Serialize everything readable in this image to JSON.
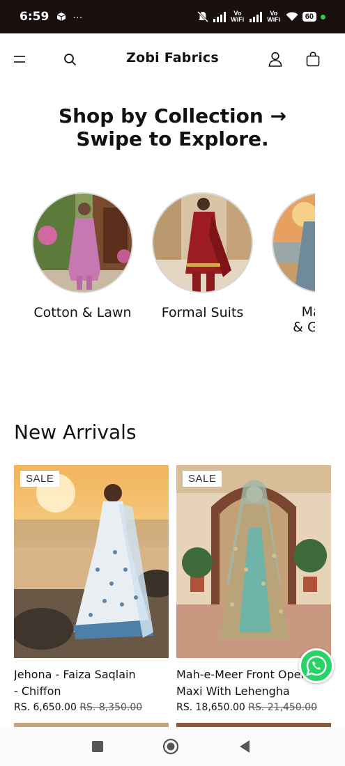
{
  "status_bar": {
    "time": "6:59",
    "notif_more": "···",
    "network_1": "Vo WiFi",
    "network_2": "Vo WiFi",
    "battery": "60"
  },
  "header": {
    "brand": "Zobi Fabrics"
  },
  "collections": {
    "heading_line1": "Shop by Collection →",
    "heading_line2": "Swipe to Explore.",
    "items": [
      {
        "label": "Cotton & Lawn"
      },
      {
        "label": "Formal Suits"
      },
      {
        "label": "Maxi's",
        "label_line2": "& Gowns"
      }
    ]
  },
  "new_arrivals": {
    "title": "New Arrivals",
    "products": [
      {
        "badge": "SALE",
        "name_line1": "Jehona - Faiza Saqlain",
        "name_line2": "- Chiffon",
        "price": "RS. 6,650.00",
        "compare_price": "RS. 8,350.00"
      },
      {
        "badge": "SALE",
        "name_line1": "Mah-e-Meer Front Open",
        "name_line2": "Maxi With Lehengha",
        "price": "RS. 18,650.00",
        "compare_price": "RS. 21,450.00"
      }
    ]
  },
  "colors": {
    "status_bg": "#1a1010",
    "whatsapp": "#25d366",
    "text": "#111111"
  },
  "icons": [
    "menu-icon",
    "search-icon",
    "account-icon",
    "cart-icon",
    "whatsapp-icon",
    "recents-icon",
    "home-icon",
    "back-icon"
  ]
}
